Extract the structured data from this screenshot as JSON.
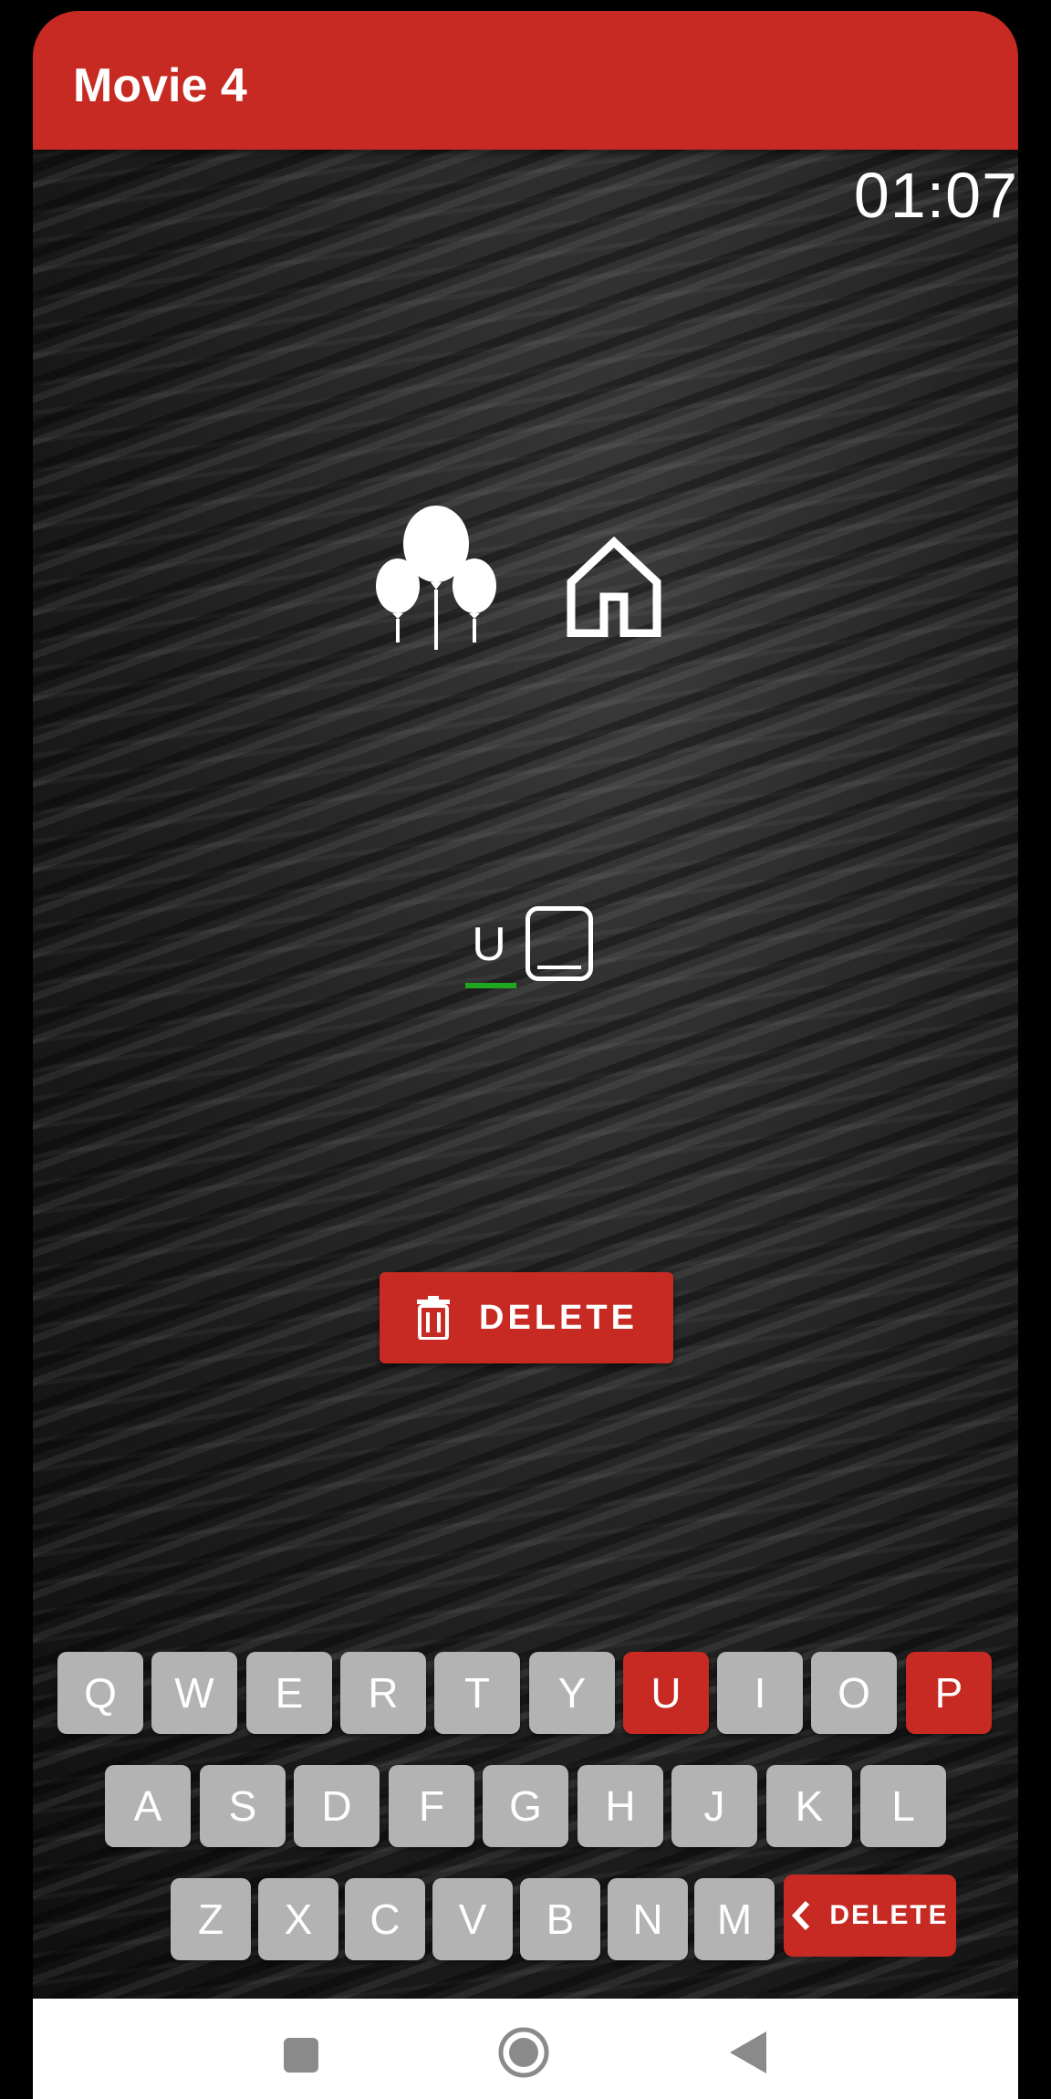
{
  "appbar": {
    "title": "Movie 4"
  },
  "timer": "01:07",
  "clue_icons": [
    "balloons-icon",
    "house-icon"
  ],
  "answer": {
    "slots": [
      "U",
      ""
    ]
  },
  "delete_button": {
    "label": "DELETE",
    "icon": "trash-icon"
  },
  "keyboard": {
    "rows": [
      [
        "Q",
        "W",
        "E",
        "R",
        "T",
        "Y",
        "U",
        "I",
        "O",
        "P"
      ],
      [
        "A",
        "S",
        "D",
        "F",
        "G",
        "H",
        "J",
        "K",
        "L"
      ],
      [
        "Z",
        "X",
        "C",
        "V",
        "B",
        "N",
        "M"
      ]
    ],
    "used_keys": [
      "U",
      "P"
    ],
    "delete_label": "DELETE"
  },
  "navbar": {
    "buttons": [
      "recents-icon",
      "home-icon",
      "back-icon"
    ]
  },
  "colors": {
    "accent": "#c62a22",
    "key": "#b3b3b3",
    "underline": "#1fa81f"
  }
}
